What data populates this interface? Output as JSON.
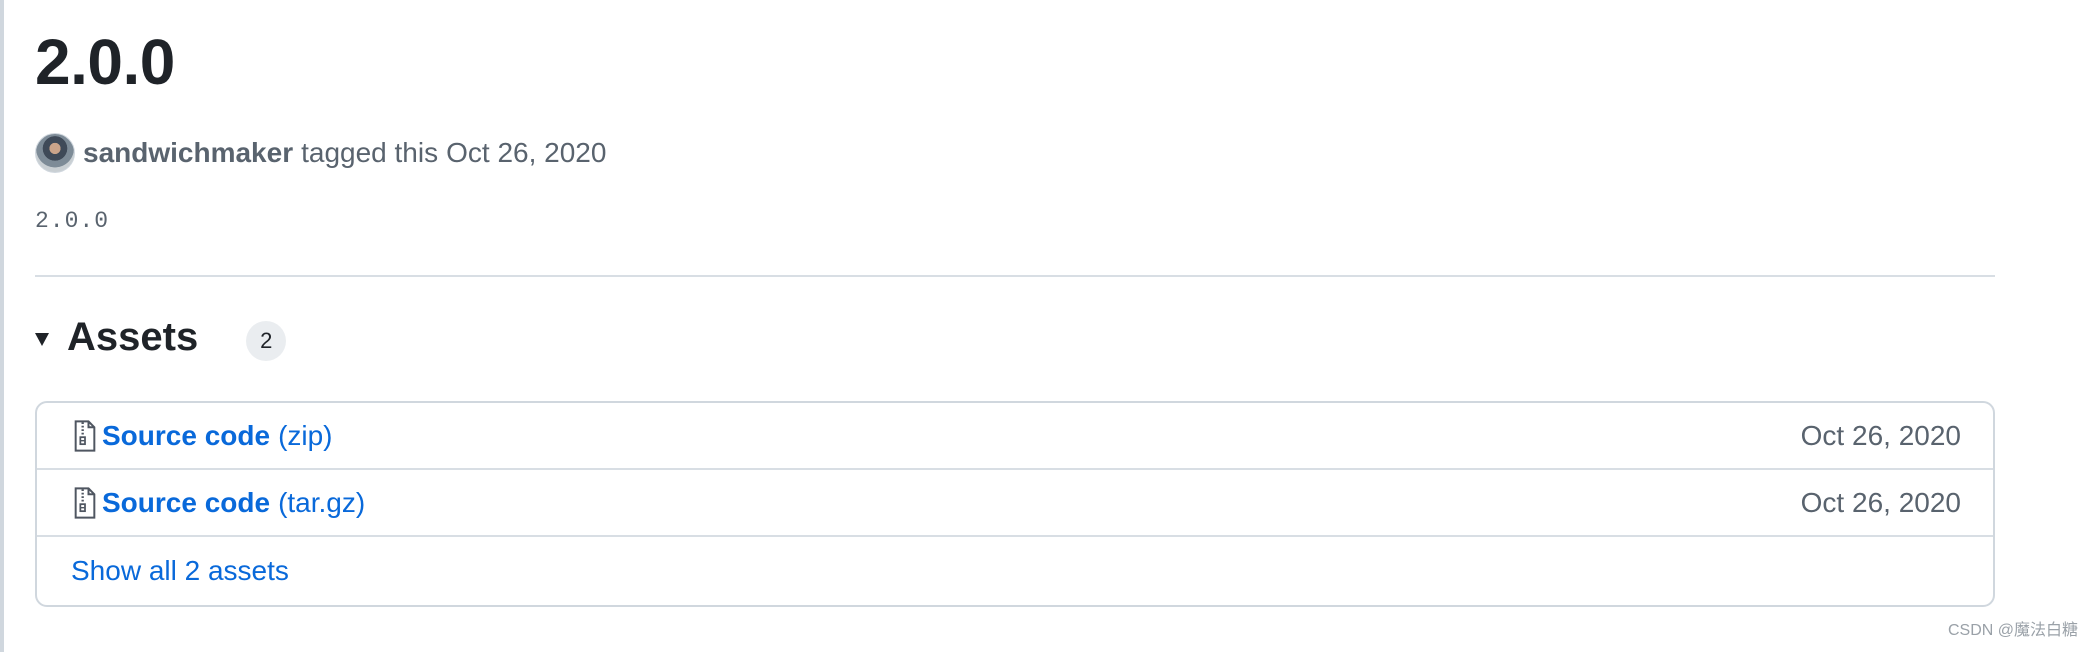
{
  "release": {
    "title": "2.0.0",
    "author": "sandwichmaker",
    "tagged_text": "tagged this",
    "date": "Oct 26, 2020",
    "body": "2.0.0"
  },
  "assets": {
    "heading": "Assets",
    "count": "2",
    "items": [
      {
        "label": "Source code",
        "format": "(zip)",
        "date": "Oct 26, 2020",
        "icon": "file-zip-icon"
      },
      {
        "label": "Source code",
        "format": "(tar.gz)",
        "date": "Oct 26, 2020",
        "icon": "file-zip-icon"
      }
    ],
    "show_all": "Show all 2 assets"
  },
  "watermark": "CSDN @魔法白糖",
  "colors": {
    "link": "#0969da",
    "text": "#1f2328",
    "muted": "#59636e",
    "border": "#d0d7de"
  }
}
